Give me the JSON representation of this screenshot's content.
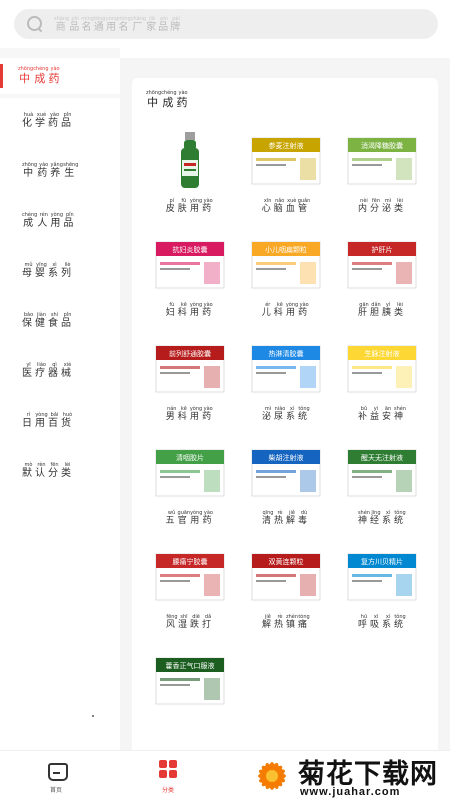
{
  "search": {
    "placeholder": "商品名/通用名/厂家/品牌",
    "pinyin": [
      "shāng",
      "pǐn",
      "míng",
      "tōng",
      "yòng",
      "míng",
      "chǎng",
      "jiā",
      "pǐn",
      "pái"
    ]
  },
  "sidebar": {
    "active": {
      "label": "中成药",
      "pinyin": [
        "zhōng",
        "chéng",
        "yào"
      ]
    },
    "items": [
      {
        "label": "化学药品",
        "pinyin": [
          "huà",
          "xué",
          "yào",
          "pǐn"
        ]
      },
      {
        "label": "中药养生",
        "pinyin": [
          "zhōng",
          "yào",
          "yǎng",
          "shēng"
        ]
      },
      {
        "label": "成人用品",
        "pinyin": [
          "chéng",
          "rén",
          "yòng",
          "pǐn"
        ]
      },
      {
        "label": "母婴系列",
        "pinyin": [
          "mǔ",
          "yīng",
          "xì",
          "liè"
        ]
      },
      {
        "label": "保健食品",
        "pinyin": [
          "bǎo",
          "jiàn",
          "shí",
          "pǐn"
        ]
      },
      {
        "label": "医疗器械",
        "pinyin": [
          "yī",
          "liáo",
          "qì",
          "xiè"
        ]
      },
      {
        "label": "日用百货",
        "pinyin": [
          "rì",
          "yòng",
          "bǎi",
          "huò"
        ]
      },
      {
        "label": "默认分类",
        "pinyin": [
          "mò",
          "rèn",
          "fēn",
          "lèi"
        ]
      }
    ]
  },
  "panel": {
    "title": "中成药",
    "title_pinyin": [
      "zhōng",
      "chéng",
      "yào"
    ],
    "categories": [
      {
        "label": "皮肤用药",
        "pinyin": [
          "pí",
          "fū",
          "yòng",
          "yào"
        ],
        "box_text": "",
        "color": "#2e7d32",
        "style": "bottle"
      },
      {
        "label": "心脑血管",
        "pinyin": [
          "xīn",
          "nǎo",
          "xuè",
          "guǎn"
        ],
        "box_text": "参麦注射液",
        "color": "#c8a400",
        "style": "box-yellow"
      },
      {
        "label": "内分泌类",
        "pinyin": [
          "nèi",
          "fēn",
          "mì",
          "lèi"
        ],
        "box_text": "消渴降糖胶囊",
        "color": "#7cb342",
        "style": "box-green"
      },
      {
        "label": "妇科用药",
        "pinyin": [
          "fù",
          "kē",
          "yòng",
          "yào"
        ],
        "box_text": "抗妇炎胶囊",
        "color": "#d81b60",
        "style": "box-pink"
      },
      {
        "label": "儿科用药",
        "pinyin": [
          "ér",
          "kē",
          "yòng",
          "yào"
        ],
        "box_text": "小儿咽扁颗粒",
        "color": "#f9a825",
        "style": "box-gold"
      },
      {
        "label": "肝胆胰类",
        "pinyin": [
          "gān",
          "dǎn",
          "yí",
          "lèi"
        ],
        "box_text": "护肝片",
        "color": "#c62828",
        "style": "box-red"
      },
      {
        "label": "男科用药",
        "pinyin": [
          "nán",
          "kē",
          "yòng",
          "yào"
        ],
        "box_text": "前列舒通胶囊",
        "color": "#b71c1c",
        "style": "box-darkred"
      },
      {
        "label": "泌尿系统",
        "pinyin": [
          "mì",
          "niào",
          "xì",
          "tǒng"
        ],
        "box_text": "热淋清胶囊",
        "color": "#1e88e5",
        "style": "box-blue"
      },
      {
        "label": "补益安神",
        "pinyin": [
          "bǔ",
          "yì",
          "ān",
          "shén"
        ],
        "box_text": "生脉注射液",
        "color": "#fdd835",
        "style": "box-lemon"
      },
      {
        "label": "五官用药",
        "pinyin": [
          "wǔ",
          "guān",
          "yòng",
          "yào"
        ],
        "box_text": "清咽胶片",
        "color": "#43a047",
        "style": "box-white-green"
      },
      {
        "label": "清热解毒",
        "pinyin": [
          "qīng",
          "rè",
          "jiě",
          "dú"
        ],
        "box_text": "柴胡注射液",
        "color": "#1565c0",
        "style": "box-white-blue"
      },
      {
        "label": "神经系统",
        "pinyin": [
          "shén",
          "jīng",
          "xì",
          "tǒng"
        ],
        "box_text": "醒天无注射液",
        "color": "#2e7d32",
        "style": "box-darkgreen"
      },
      {
        "label": "风湿跌打",
        "pinyin": [
          "fēng",
          "shī",
          "diē",
          "dǎ"
        ],
        "box_text": "腰痛宁胶囊",
        "color": "#c62828",
        "style": "box-redband"
      },
      {
        "label": "解热镇痛",
        "pinyin": [
          "jiě",
          "rè",
          "zhèn",
          "tòng"
        ],
        "box_text": "双黄连颗粒",
        "color": "#b71c1c",
        "style": "box-redstripe"
      },
      {
        "label": "呼吸系统",
        "pinyin": [
          "hū",
          "xī",
          "xì",
          "tǒng"
        ],
        "box_text": "复方川贝精片",
        "color": "#0288d1",
        "style": "box-lightblue"
      },
      {
        "label": "",
        "pinyin": [],
        "box_text": "藿香正气口服液",
        "color": "#1b5e20",
        "style": "box-herb"
      }
    ]
  },
  "tabbar": {
    "home": {
      "label": "首页",
      "icon": "home-icon"
    },
    "category": {
      "label": "分类",
      "icon": "category-icon"
    }
  },
  "watermark": {
    "title": "菊花下载网",
    "url": "www.juahar.com"
  },
  "colors": {
    "accent": "#e53935",
    "sidebar_bg": "#f7f7f7",
    "search_bg": "#eeeeee"
  }
}
